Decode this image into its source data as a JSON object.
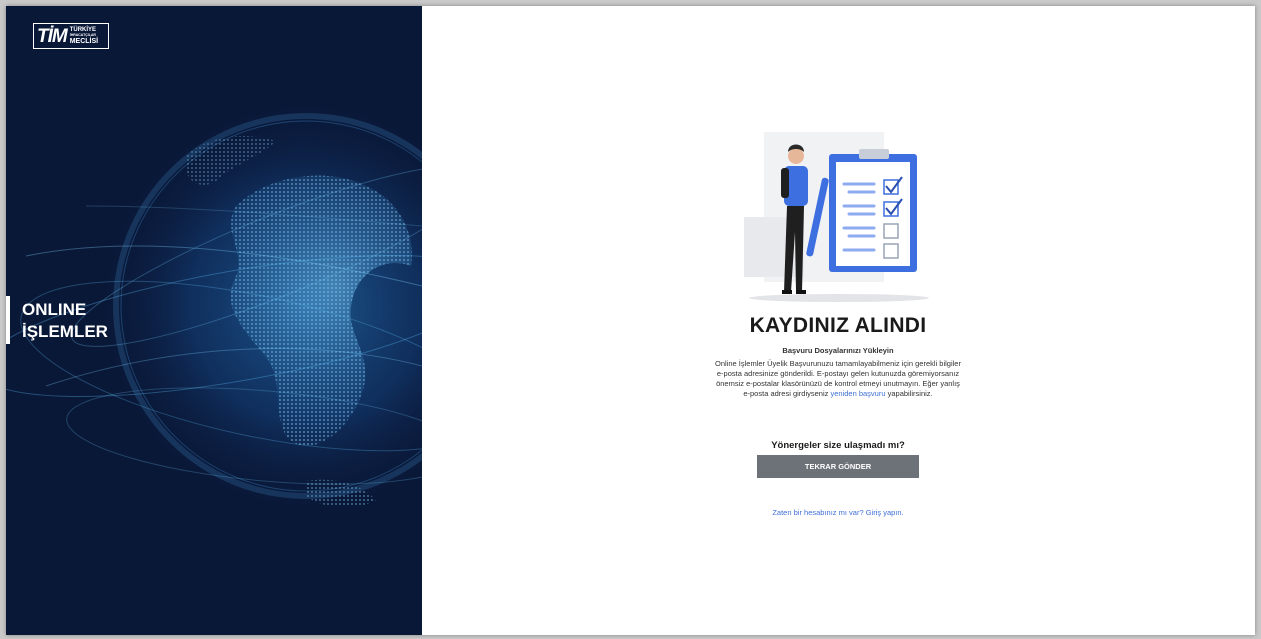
{
  "brand": {
    "logo_mark": "TİM",
    "logo_line1": "TÜRKİYE",
    "logo_line2": "İHRACATÇILAR",
    "logo_line3": "MECLİSİ"
  },
  "sidebar": {
    "title_line1": "ONLINE",
    "title_line2": "İŞLEMLER"
  },
  "content": {
    "title": "KAYDINIZ ALINDI",
    "subtitle": "Başvuru Dosyalarınızı Yükleyin",
    "body_text": "Online İşlemler Üyelik Başvurunuzu tamamlayabilmeniz için gerekli bilgiler e-posta adresinize gönderildi. E-postayı gelen kutunuzda göremiyorsanız önemsiz e-postalar klasörünüzü de kontrol etmeyi unutmayın. Eğer yanlış e-posta adresi girdiyseniz",
    "reapply_link": "yeniden başvuru",
    "body_text_end": " yapabilirsiniz.",
    "question": "Yönergeler size ulaşmadı mı?",
    "resend_button": "TEKRAR GÖNDER",
    "login_link": "Zaten bir hesabınız mı var? Giriş yapın."
  },
  "colors": {
    "left_panel_bg": "#0a1838",
    "accent_blue": "#3f6fd8",
    "button_bg": "#6d7178"
  },
  "icons": [
    "globe-image",
    "checklist-illustration"
  ]
}
